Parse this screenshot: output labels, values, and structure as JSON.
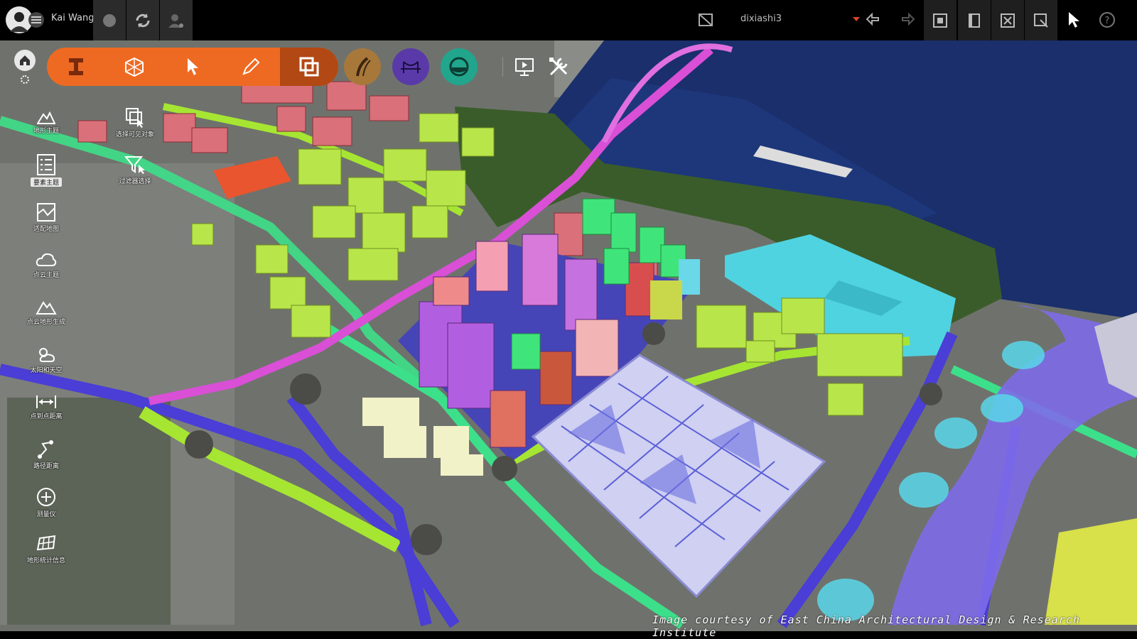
{
  "topbar": {
    "user_name": "Kai Wang",
    "scene_name": "dixiashi3",
    "icons": [
      "avatar-icon",
      "menu-icon",
      "chat-icon",
      "sync-icon",
      "user-settings-icon",
      "scene-file-icon",
      "dropdown-caret",
      "undo-icon",
      "redo-icon",
      "layer-icon",
      "book-icon",
      "fullscreen-icon",
      "screenshot-icon",
      "pointer-icon",
      "help-icon"
    ]
  },
  "main_toolbar": {
    "buttons": [
      "model-tool-icon",
      "box-tool-icon",
      "select-tool-icon",
      "pen-tool-icon",
      "overlay-tool-icon"
    ],
    "circle_buttons": [
      "road-tool-icon",
      "bridge-tool-icon",
      "tunnel-tool-icon"
    ],
    "extra_buttons": [
      "presentation-icon",
      "tools-icon"
    ],
    "accent": "#ee6a22",
    "active_accent": "#b24813"
  },
  "left_tools": [
    {
      "label": "地形主题"
    },
    {
      "label": "要素主题"
    },
    {
      "label": "适配地图"
    },
    {
      "label": "点云主题"
    },
    {
      "label": "点云地形生成"
    },
    {
      "label": "太阳和天空"
    },
    {
      "label": "点到点距离"
    },
    {
      "label": "路径距离"
    },
    {
      "label": "测量仪"
    },
    {
      "label": "地形统计信息"
    }
  ],
  "sub_tools": [
    {
      "label": "选择可见对象"
    },
    {
      "label": "过滤器选择"
    }
  ],
  "credit": "Image courtesy of East China Architectural Design & Research Institute"
}
